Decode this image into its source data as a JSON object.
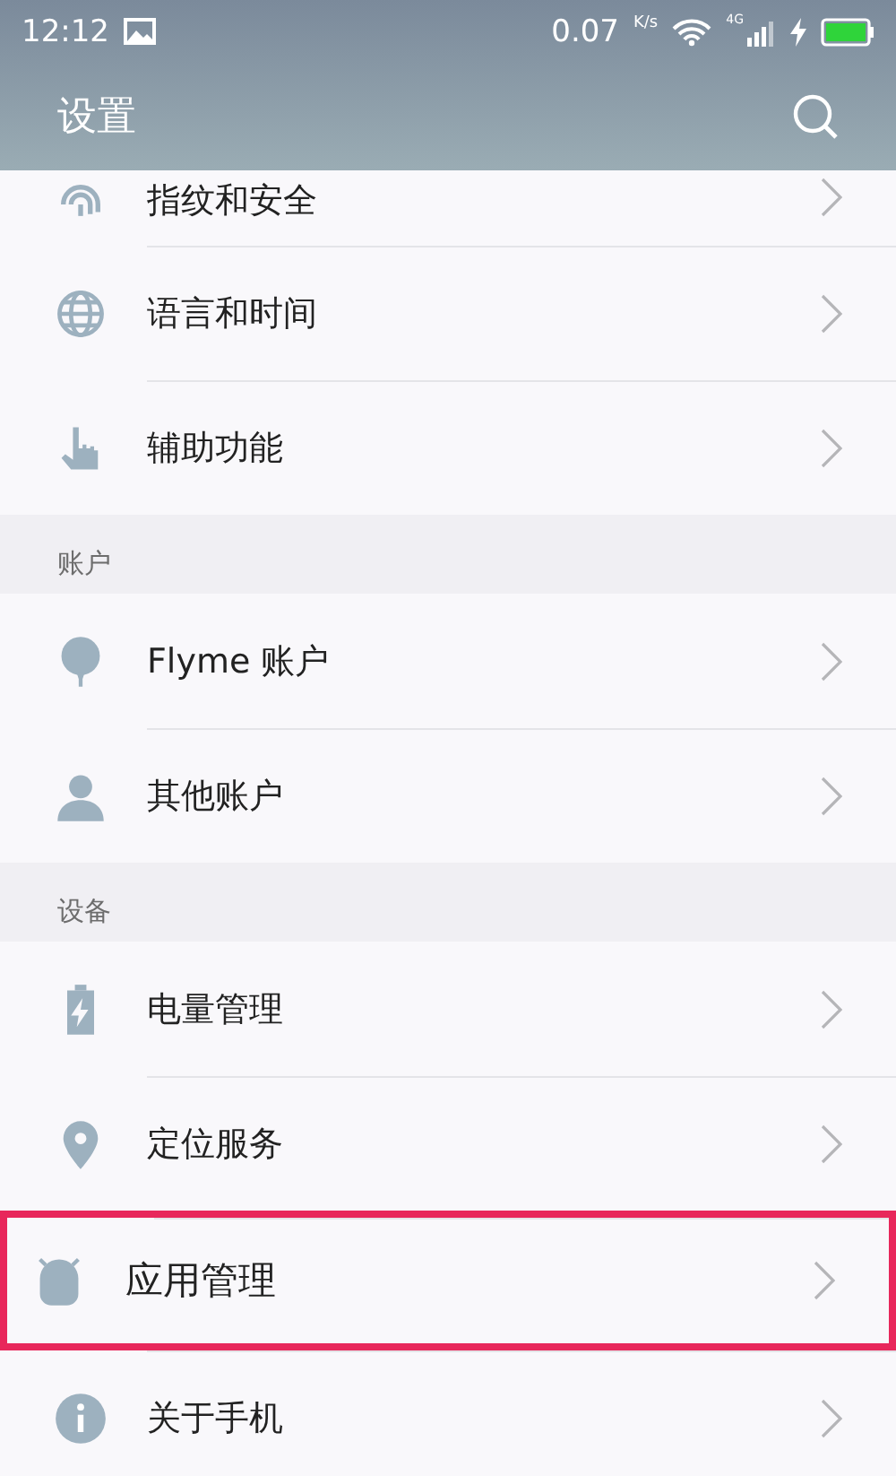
{
  "status_bar": {
    "time": "12:12",
    "speed": "0.07",
    "speed_unit": "K/s",
    "network": "4G"
  },
  "header": {
    "title": "设置"
  },
  "sections": [
    {
      "items": [
        {
          "label": "指纹和安全",
          "highlighted": false
        },
        {
          "label": "语言和时间",
          "highlighted": false
        },
        {
          "label": "辅助功能",
          "highlighted": false
        }
      ]
    },
    {
      "title": "账户",
      "items": [
        {
          "label": "Flyme 账户",
          "highlighted": false
        },
        {
          "label": "其他账户",
          "highlighted": false
        }
      ]
    },
    {
      "title": "设备",
      "items": [
        {
          "label": "电量管理",
          "highlighted": false
        },
        {
          "label": "定位服务",
          "highlighted": false
        },
        {
          "label": "应用管理",
          "highlighted": true
        },
        {
          "label": "关于手机",
          "highlighted": false
        }
      ]
    }
  ]
}
